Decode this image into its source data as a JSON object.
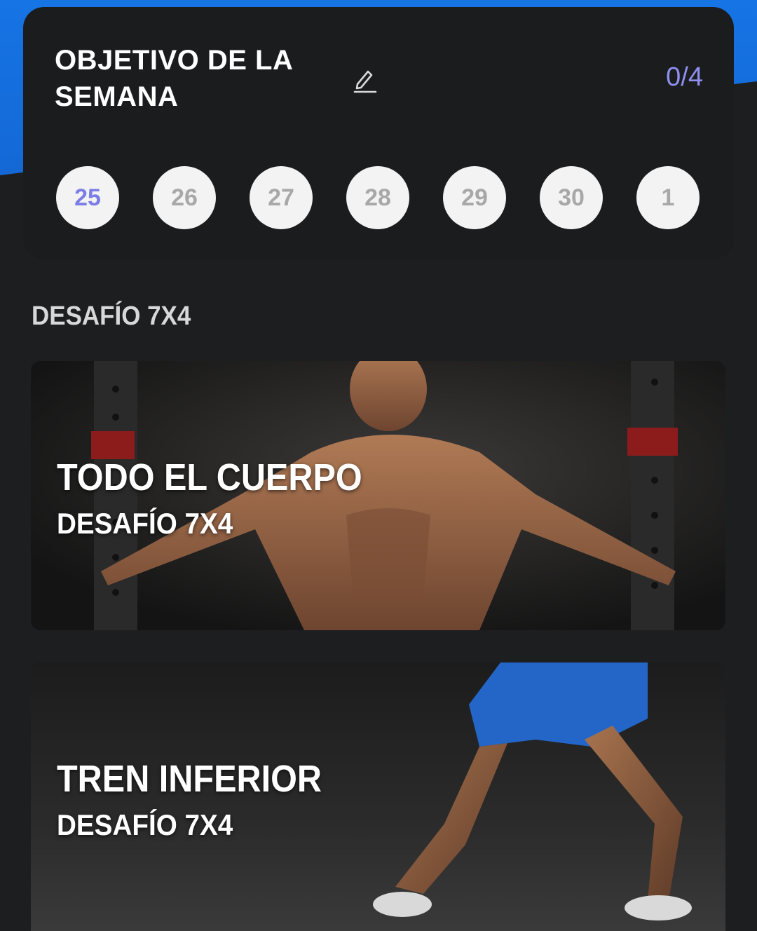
{
  "weekly_goal": {
    "title_line1": "OBJETIVO DE LA",
    "title_line2": "SEMANA",
    "progress": "0/4",
    "edit_icon": "pencil-icon",
    "days": [
      "25",
      "26",
      "27",
      "28",
      "29",
      "30",
      "1"
    ],
    "current_day": "25"
  },
  "section": {
    "title": "DESAFÍO 7X4"
  },
  "challenges": [
    {
      "title": "TODO EL CUERPO",
      "subtitle": "DESAFÍO 7X4",
      "image": "full-body-athlete-image"
    },
    {
      "title": "TREN INFERIOR",
      "subtitle": "DESAFÍO 7X4",
      "image": "lower-body-athlete-image"
    }
  ],
  "colors": {
    "background": "#1d1e20",
    "card": "#1b1c1e",
    "accent_blue": "#1674e4",
    "progress_text": "#8f8ff0",
    "current_day_text": "#7b7ee6",
    "day_circle": "#f3f3f3"
  }
}
